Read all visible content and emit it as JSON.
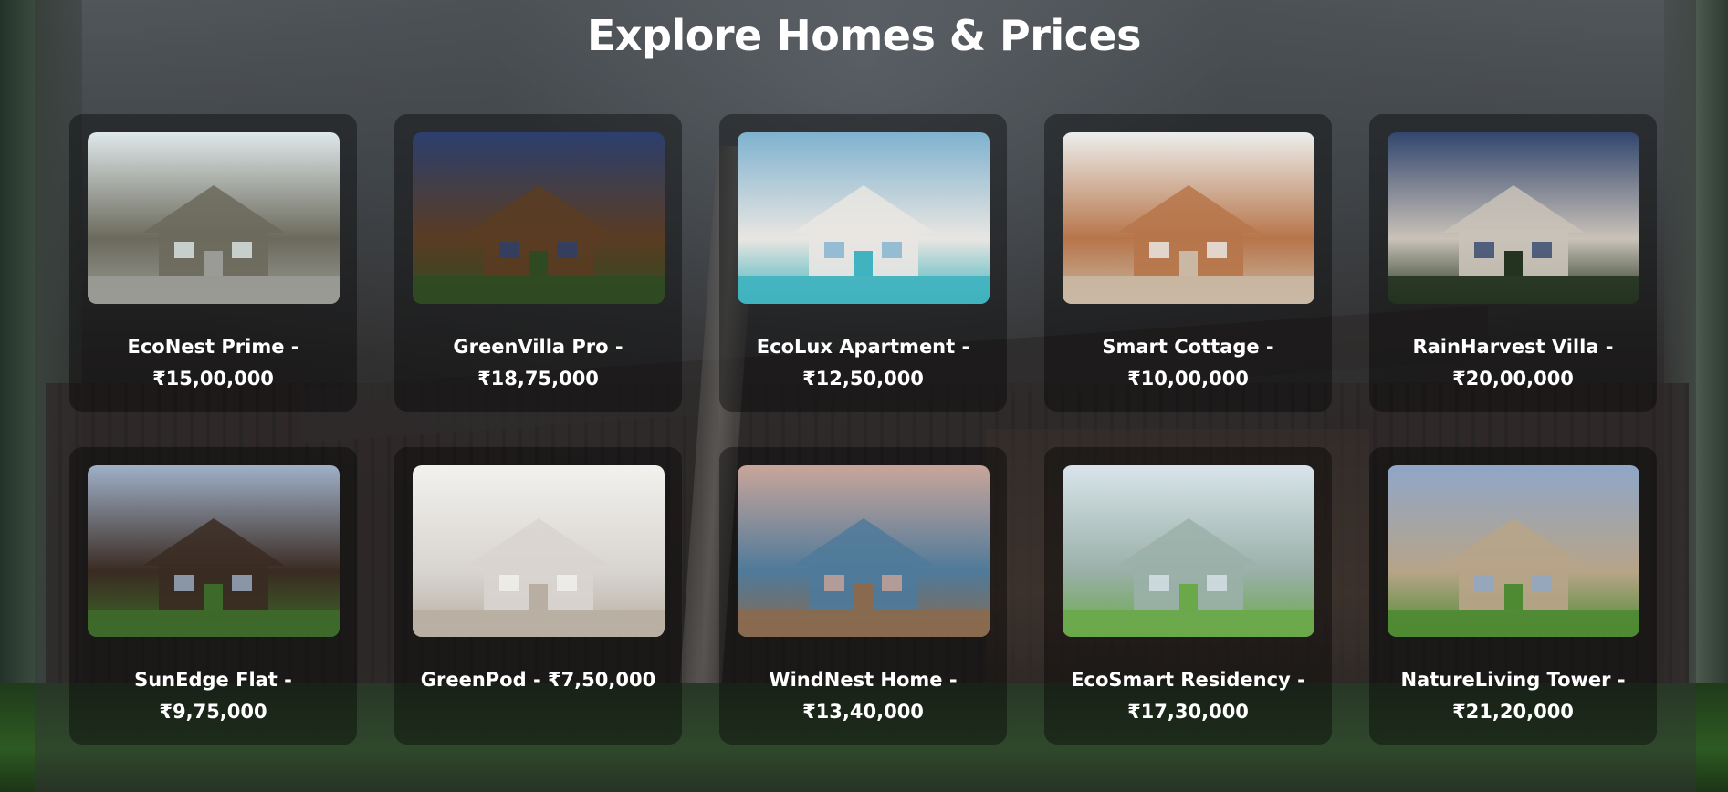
{
  "page": {
    "title": "Explore Homes & Prices"
  },
  "homes": [
    {
      "name": "EcoNest Prime -",
      "price": "₹15,00,000",
      "image": "stone-house-with-driveway",
      "colors": {
        "sky": "#dfe8ea",
        "mid": "#6b6a5c",
        "ground": "#9a9a96"
      }
    },
    {
      "name": "GreenVilla Pro -",
      "price": "₹18,75,000",
      "image": "wooden-house-at-dusk",
      "colors": {
        "sky": "#2c3f6e",
        "mid": "#5a3c22",
        "ground": "#2f4a22"
      }
    },
    {
      "name": "EcoLux Apartment -",
      "price": "₹12,50,000",
      "image": "modern-villa-with-pool",
      "colors": {
        "sky": "#7fb2cf",
        "mid": "#e9e6e2",
        "ground": "#3fb3bf"
      }
    },
    {
      "name": "Smart Cottage -",
      "price": "₹10,00,000",
      "image": "living-room-interior",
      "colors": {
        "sky": "#eceeec",
        "mid": "#b7754a",
        "ground": "#c9b8a4"
      }
    },
    {
      "name": "RainHarvest Villa -",
      "price": "₹20,00,000",
      "image": "mediterranean-villa-night",
      "colors": {
        "sky": "#32466e",
        "mid": "#c9c2b8",
        "ground": "#23331f"
      }
    },
    {
      "name": "SunEdge Flat -",
      "price": "₹9,75,000",
      "image": "modern-house-with-tree",
      "colors": {
        "sky": "#9fb0c8",
        "mid": "#3a2b22",
        "ground": "#3d6a2a"
      }
    },
    {
      "name": "GreenPod - ₹7,50,000",
      "price": "",
      "image": "white-kitchen-interior",
      "colors": {
        "sky": "#f2f1ee",
        "mid": "#d8d4cf",
        "ground": "#b8aea2"
      }
    },
    {
      "name": "WindNest Home -",
      "price": "₹13,40,000",
      "image": "dining-room-sea-view",
      "colors": {
        "sky": "#c9a59a",
        "mid": "#4f7a9a",
        "ground": "#8a6a4e"
      }
    },
    {
      "name": "EcoSmart Residency -",
      "price": "₹17,30,000",
      "image": "green-city-towers",
      "colors": {
        "sky": "#d8e4ea",
        "mid": "#9ab0a8",
        "ground": "#6aa84a"
      }
    },
    {
      "name": "NatureLiving Tower -",
      "price": "₹21,20,000",
      "image": "park-with-skyline",
      "colors": {
        "sky": "#8fa6c8",
        "mid": "#b7a488",
        "ground": "#4e8a32"
      }
    }
  ]
}
